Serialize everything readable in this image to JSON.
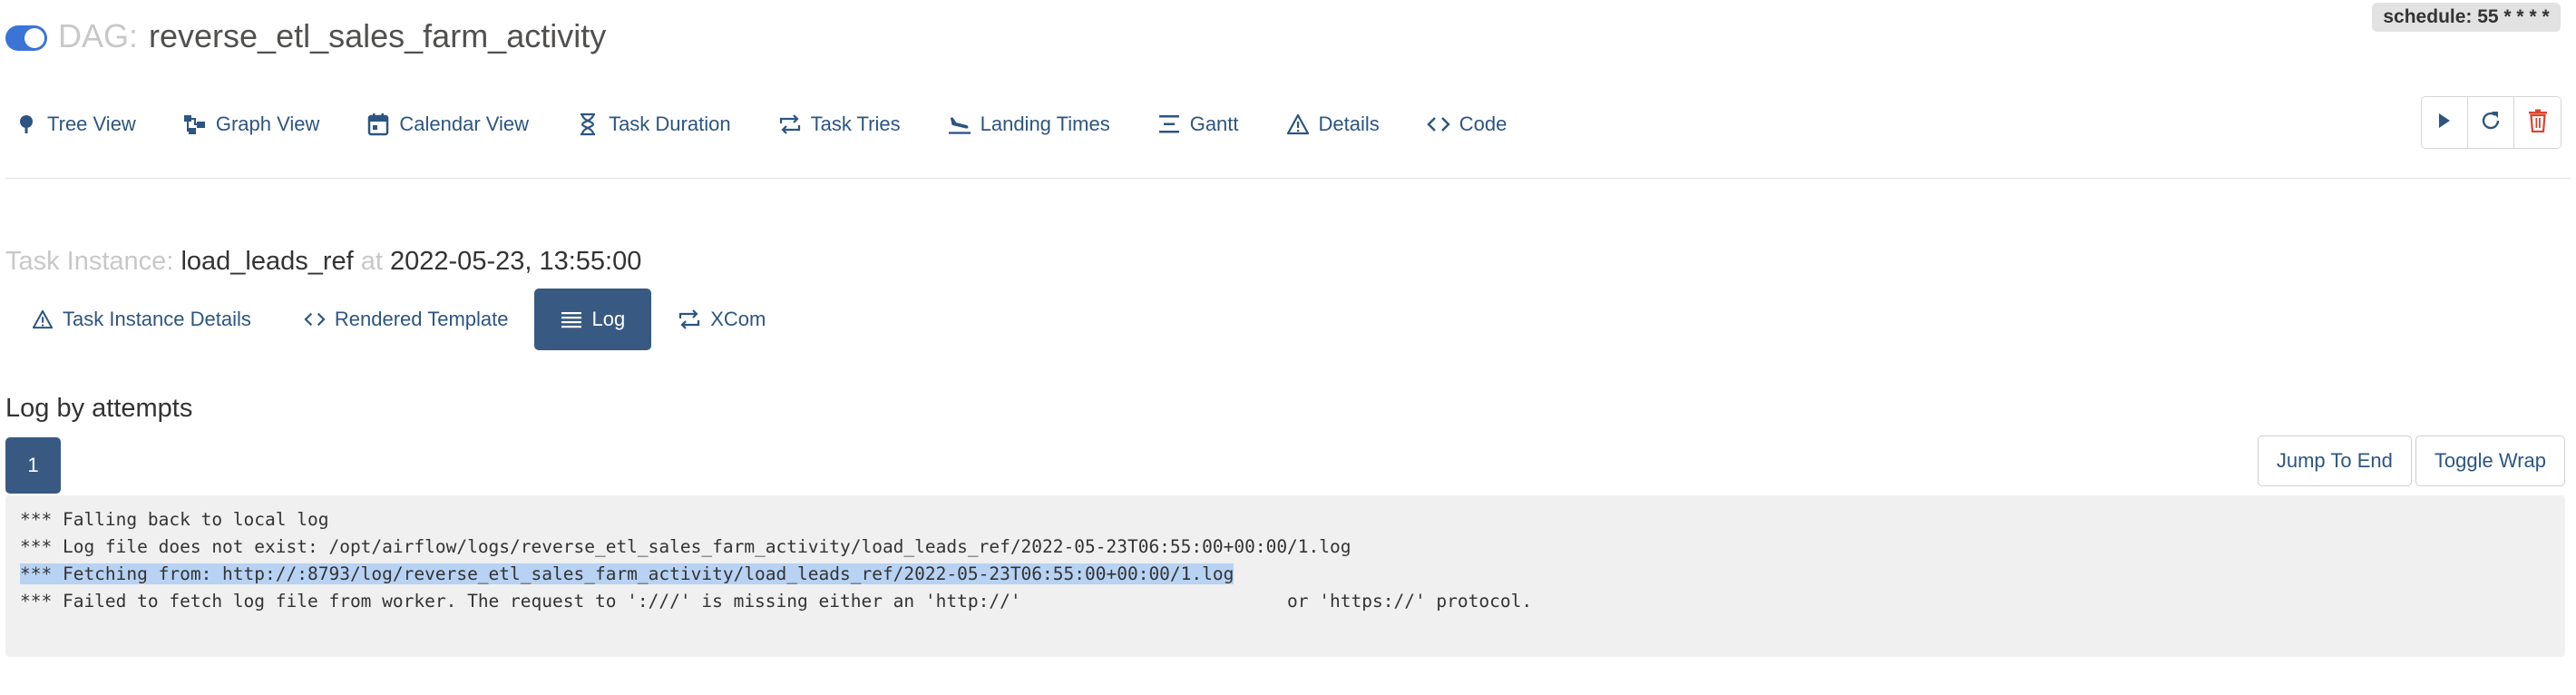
{
  "header": {
    "dag_label": "DAG:",
    "dag_id": "reverse_etl_sales_farm_activity",
    "schedule": "schedule: 55 * * * *",
    "toggle_state": "on"
  },
  "nav": {
    "items": [
      {
        "label": "Tree View",
        "icon": "tree-icon"
      },
      {
        "label": "Graph View",
        "icon": "graph-icon"
      },
      {
        "label": "Calendar View",
        "icon": "calendar-icon"
      },
      {
        "label": "Task Duration",
        "icon": "hourglass-icon"
      },
      {
        "label": "Task Tries",
        "icon": "retry-arrows-icon"
      },
      {
        "label": "Landing Times",
        "icon": "plane-landing-icon"
      },
      {
        "label": "Gantt",
        "icon": "gantt-icon"
      },
      {
        "label": "Details",
        "icon": "warning-triangle-icon"
      },
      {
        "label": "Code",
        "icon": "code-icon"
      }
    ],
    "actions": [
      {
        "name": "trigger",
        "icon": "play-icon"
      },
      {
        "name": "refresh",
        "icon": "refresh-icon"
      },
      {
        "name": "delete",
        "icon": "trash-icon"
      }
    ]
  },
  "task_instance": {
    "prefix": "Task Instance:",
    "task_id": "load_leads_ref",
    "at": "at",
    "execution_date": "2022-05-23, 13:55:00",
    "tabs": [
      {
        "label": "Task Instance Details",
        "icon": "warning-triangle-icon",
        "active": false
      },
      {
        "label": "Rendered Template",
        "icon": "code-icon",
        "active": false
      },
      {
        "label": "Log",
        "icon": "list-icon",
        "active": true
      },
      {
        "label": "XCom",
        "icon": "exchange-icon",
        "active": false
      }
    ]
  },
  "log": {
    "heading": "Log by attempts",
    "attempts": [
      "1"
    ],
    "jump_to_end": "Jump To End",
    "toggle_wrap": "Toggle Wrap",
    "lines": [
      "*** Falling back to local log",
      "*** Log file does not exist: /opt/airflow/logs/reverse_etl_sales_farm_activity/load_leads_ref/2022-05-23T06:55:00+00:00/1.log",
      "*** Fetching from: http://:8793/log/reverse_etl_sales_farm_activity/load_leads_ref/2022-05-23T06:55:00+00:00/1.log",
      "*** Failed to fetch log file from worker. The request to ':///' is missing either an 'http://'                         or 'https://' protocol."
    ],
    "highlighted_line": 2
  },
  "colors": {
    "accent": "#2c5582",
    "active_tab": "#385a82",
    "toggle": "#3a74d6",
    "delete": "#d9442e",
    "selection": "#b7d2f3"
  }
}
